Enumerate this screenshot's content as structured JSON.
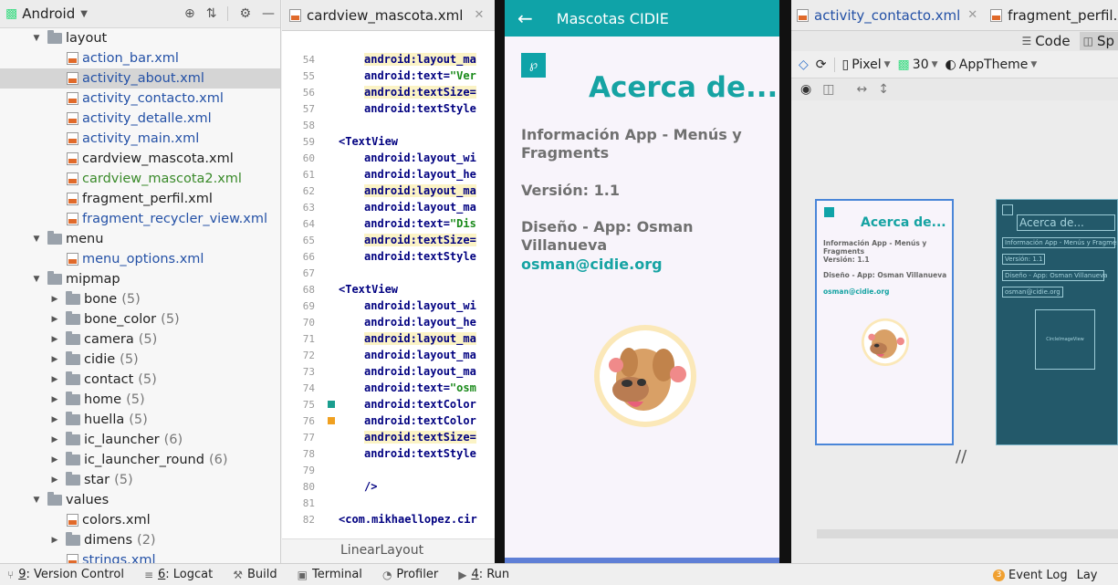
{
  "project": {
    "title": "Android",
    "tree": [
      {
        "label": "layout",
        "kind": "folder",
        "expanded": true,
        "depth": 0
      },
      {
        "label": "action_bar.xml",
        "kind": "file",
        "style": "link",
        "depth": 1
      },
      {
        "label": "activity_about.xml",
        "kind": "file",
        "style": "link",
        "depth": 1,
        "selected": true
      },
      {
        "label": "activity_contacto.xml",
        "kind": "file",
        "style": "link",
        "depth": 1
      },
      {
        "label": "activity_detalle.xml",
        "kind": "file",
        "style": "link",
        "depth": 1
      },
      {
        "label": "activity_main.xml",
        "kind": "file",
        "style": "link",
        "depth": 1
      },
      {
        "label": "cardview_mascota.xml",
        "kind": "file",
        "style": "plain",
        "depth": 1
      },
      {
        "label": "cardview_mascota2.xml",
        "kind": "file",
        "style": "added",
        "depth": 1
      },
      {
        "label": "fragment_perfil.xml",
        "kind": "file",
        "style": "plain",
        "depth": 1
      },
      {
        "label": "fragment_recycler_view.xml",
        "kind": "file",
        "style": "link",
        "depth": 1
      },
      {
        "label": "menu",
        "kind": "folder",
        "expanded": true,
        "depth": 0
      },
      {
        "label": "menu_options.xml",
        "kind": "file",
        "style": "link",
        "depth": 1
      },
      {
        "label": "mipmap",
        "kind": "folder",
        "expanded": true,
        "depth": 0
      },
      {
        "label": "bone",
        "kind": "subfolder",
        "count": "(5)",
        "depth": 1
      },
      {
        "label": "bone_color",
        "kind": "subfolder",
        "count": "(5)",
        "depth": 1
      },
      {
        "label": "camera",
        "kind": "subfolder",
        "count": "(5)",
        "depth": 1
      },
      {
        "label": "cidie",
        "kind": "subfolder",
        "count": "(5)",
        "depth": 1
      },
      {
        "label": "contact",
        "kind": "subfolder",
        "count": "(5)",
        "depth": 1
      },
      {
        "label": "home",
        "kind": "subfolder",
        "count": "(5)",
        "depth": 1
      },
      {
        "label": "huella",
        "kind": "subfolder",
        "count": "(5)",
        "depth": 1
      },
      {
        "label": "ic_launcher",
        "kind": "subfolder",
        "count": "(6)",
        "depth": 1
      },
      {
        "label": "ic_launcher_round",
        "kind": "subfolder",
        "count": "(6)",
        "depth": 1
      },
      {
        "label": "star",
        "kind": "subfolder",
        "count": "(5)",
        "depth": 1
      },
      {
        "label": "values",
        "kind": "folder",
        "expanded": true,
        "depth": 0
      },
      {
        "label": "colors.xml",
        "kind": "file",
        "style": "plain",
        "depth": 1
      },
      {
        "label": "dimens",
        "kind": "subfolder",
        "count": "(2)",
        "depth": 1
      },
      {
        "label": "strings.xml",
        "kind": "file",
        "style": "link",
        "depth": 1
      }
    ]
  },
  "editor": {
    "tab_label": "cardview_mascota.xml",
    "lines": [
      {
        "n": "54",
        "text": "android:layout_ma",
        "hl": true,
        "indent": 2
      },
      {
        "n": "55",
        "text": "android:text=",
        "value": "\"Ver",
        "indent": 2
      },
      {
        "n": "56",
        "text": "android:textSize=",
        "hl": true,
        "indent": 2
      },
      {
        "n": "57",
        "text": "android:textStyle",
        "indent": 2
      },
      {
        "n": "58",
        "text": "",
        "indent": 0
      },
      {
        "n": "59",
        "text": "<TextView",
        "indent": 1
      },
      {
        "n": "60",
        "text": "android:layout_wi",
        "indent": 2
      },
      {
        "n": "61",
        "text": "android:layout_he",
        "indent": 2
      },
      {
        "n": "62",
        "text": "android:layout_ma",
        "hl": true,
        "indent": 2
      },
      {
        "n": "63",
        "text": "android:layout_ma",
        "indent": 2
      },
      {
        "n": "64",
        "text": "android:text=",
        "value": "\"Dis",
        "indent": 2
      },
      {
        "n": "65",
        "text": "android:textSize=",
        "hl": true,
        "indent": 2
      },
      {
        "n": "66",
        "text": "android:textStyle",
        "indent": 2
      },
      {
        "n": "67",
        "text": "",
        "indent": 0
      },
      {
        "n": "68",
        "text": "<TextView",
        "indent": 1
      },
      {
        "n": "69",
        "text": "android:layout_wi",
        "indent": 2
      },
      {
        "n": "70",
        "text": "android:layout_he",
        "indent": 2
      },
      {
        "n": "71",
        "text": "android:layout_ma",
        "hl": true,
        "indent": 2
      },
      {
        "n": "72",
        "text": "android:layout_ma",
        "indent": 2
      },
      {
        "n": "73",
        "text": "android:layout_ma",
        "indent": 2
      },
      {
        "n": "74",
        "text": "android:text=",
        "value": "\"osm",
        "indent": 2
      },
      {
        "n": "75",
        "text": "android:textColor",
        "indent": 2,
        "marker": "#1a9e8f"
      },
      {
        "n": "76",
        "text": "android:textColor",
        "indent": 2,
        "marker": "#f0a020"
      },
      {
        "n": "77",
        "text": "android:textSize=",
        "hl": true,
        "indent": 2
      },
      {
        "n": "78",
        "text": "android:textStyle",
        "indent": 2
      },
      {
        "n": "79",
        "text": "",
        "indent": 0
      },
      {
        "n": "80",
        "text": "/>",
        "indent": 2
      },
      {
        "n": "81",
        "text": "",
        "indent": 0
      },
      {
        "n": "82",
        "text": "<com.mikhaellopez.cir",
        "indent": 1
      }
    ],
    "footer": "LinearLayout"
  },
  "emulator": {
    "app_title": "Mascotas CIDIE",
    "heading": "Acerca de...",
    "info_app": "Información App - Menús y Fragments",
    "version": "Versión: 1.1",
    "design": "Diseño - App: Osman Villanueva",
    "email": "osman@cidie.org"
  },
  "right_tabs": [
    "activity_contacto.xml",
    "fragment_perfil.xml"
  ],
  "design_editor": {
    "view_code": "Code",
    "view_split": "Sp",
    "device": "Pixel",
    "api": "30",
    "theme": "AppTheme",
    "preview": {
      "heading": "Acerca de...",
      "info_app": "Información App - Menús y Fragments",
      "version": "Versión: 1.1",
      "design": "Diseño - App: Osman Villanueva",
      "email": "osman@cidie.org"
    },
    "blueprint": {
      "heading": "Acerca de...",
      "info_app": "Información App - Menús y Fragments",
      "version": "Versión: 1.1",
      "design": "Diseño - App: Osman Villanueva",
      "email": "osman@cidie.org",
      "image_label": "CircleImageView"
    }
  },
  "bottom_bar": [
    {
      "num": "9",
      "label": ": Version Control",
      "icon": "branch-icon"
    },
    {
      "num": "6",
      "label": ": Logcat",
      "icon": "logcat-icon"
    },
    {
      "num": "",
      "label": "Build",
      "icon": "hammer-icon"
    },
    {
      "num": "",
      "label": "Terminal",
      "icon": "terminal-icon"
    },
    {
      "num": "",
      "label": "Profiler",
      "icon": "gauge-icon"
    },
    {
      "num": "4",
      "label": ": Run",
      "icon": "run-icon"
    }
  ],
  "bottom_right": {
    "event_count": "3",
    "event_log": "Event Log",
    "layout": "Lay"
  }
}
